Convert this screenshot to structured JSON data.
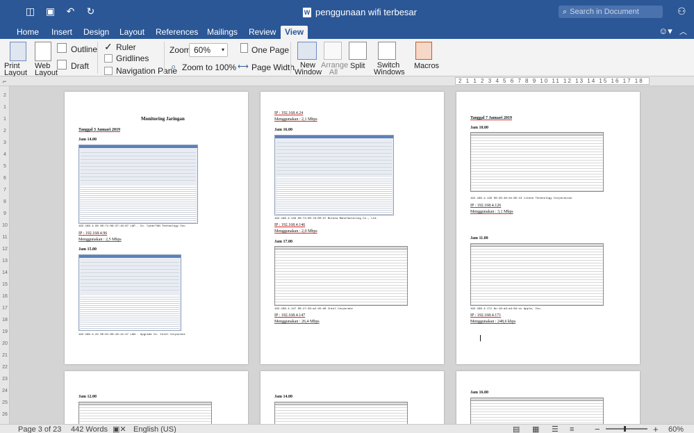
{
  "window": {
    "doc_title": "penggunaan wifi terbesar",
    "search_placeholder": "Search in Document",
    "quick_access": [
      "sidebar-icon",
      "save-icon",
      "undo-icon",
      "redo-icon"
    ]
  },
  "tabs": [
    "Home",
    "Insert",
    "Design",
    "Layout",
    "References",
    "Mailings",
    "Review",
    "View"
  ],
  "active_tab": "View",
  "ribbon": {
    "views": {
      "print_layout": "Print Layout",
      "web_layout": "Web Layout",
      "outline": "Outline",
      "draft": "Draft"
    },
    "show": {
      "ruler": "Ruler",
      "ruler_checked": "✓",
      "gridlines": "Gridlines",
      "navigation_pane": "Navigation Pane"
    },
    "zoom": {
      "label": "Zoom:",
      "value": "60%",
      "zoom100": "Zoom to 100%",
      "one_page": "One Page",
      "page_width": "Page Width"
    },
    "window": {
      "new_window": "New Window",
      "arrange_all": "Arrange All",
      "split": "Split",
      "switch_windows": "Switch Windows"
    },
    "macros": "Macros"
  },
  "ruler": {
    "horizontal": "2 1 1 2 3 4 5 6 7 8 9 10 11 12 13 14 15 16 17 18",
    "vertical": [
      "2",
      "1",
      "1",
      "2",
      "3",
      "4",
      "5",
      "6",
      "7",
      "8",
      "9",
      "10",
      "11",
      "12",
      "13",
      "14",
      "15",
      "16",
      "17",
      "18",
      "19",
      "20",
      "21",
      "22",
      "23",
      "24",
      "25",
      "26"
    ]
  },
  "pages": {
    "p1": {
      "title": "Monitoring Jaringan",
      "date": "Tanggal 3 Januari 2019",
      "h1": "Jam 14.00",
      "ip1_footer": "192.168.4.96   00:71:06:37:16:87   LAP..  Co.  CyberTAN Technology Inc.",
      "ip1": "IP : 192.168.4.96",
      "use1": "Menggunakan : 2,5 Mbps",
      "h2": "Jam 15.00",
      "ip2_footer": "192.168.4.24   00:01:00:16:14:47   LAN..  Upgrade Co.  Intel Corporate"
    },
    "p2": {
      "ip_top": "IP : 192.168.4.24",
      "use_top": "Menggunakan : 2,1 Mbps",
      "h1": "Jam 16.00",
      "foot1": "192.168.4.146   00:72:00:79:00:37   Murata Manufacturing Co., Ltd.",
      "ip1": "IP : 192.168.4.146",
      "use1": "Menggunakan : 2,0 Mbps",
      "h2": "Jam 17.00",
      "foot2": "192.168.4.147   00:17:39:a2:45:d0   Intel Corporate",
      "ip2": "IP : 192.168.4.147",
      "use2": "Menggunakan : 26,4 Mbps"
    },
    "p3": {
      "date": "Tanggal 7 Januari 2019",
      "h1": "Jam 10.00",
      "foot1": "192.168.4.126   00:26:49:ee:85:13   Liteon Technology Corporation",
      "ip1": "IP : 192.168.4.126",
      "use1": "Menggunakan : 3,1 Mbps",
      "h2": "Jam 11.00",
      "foot2": "192.168.4.171   8c:19:a3:a4:0d:cc   Apple, Inc.",
      "ip2": "IP : 192.168.4.171",
      "use2": "Menggunakan : 248,6 kbps"
    },
    "p4": {
      "h1": "Jam 12.00"
    },
    "p5": {
      "h1": "Jam 14.00"
    },
    "p6": {
      "h1": "Jam 16.00"
    }
  },
  "status": {
    "page": "Page 3 of 23",
    "words": "442 Words",
    "language": "English (US)",
    "zoom": "60%",
    "minus": "−",
    "plus": "+"
  }
}
